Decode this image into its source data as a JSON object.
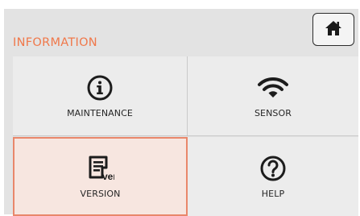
{
  "header": {
    "title": "INFORMATION",
    "home_icon": "home-icon"
  },
  "tiles": [
    {
      "label": "MAINTENANCE",
      "icon": "info-circle-icon",
      "selected": false
    },
    {
      "label": "SENSOR",
      "icon": "wifi-icon",
      "selected": false
    },
    {
      "label": "VERSION",
      "icon": "version-document-icon",
      "icon_text": "ver.",
      "selected": true
    },
    {
      "label": "HELP",
      "icon": "help-circle-icon",
      "selected": false
    }
  ],
  "colors": {
    "title": "#f0784a",
    "selected_fill": "#f7e6e0",
    "selected_border": "#e9876b",
    "tile_bg": "#ececec"
  }
}
